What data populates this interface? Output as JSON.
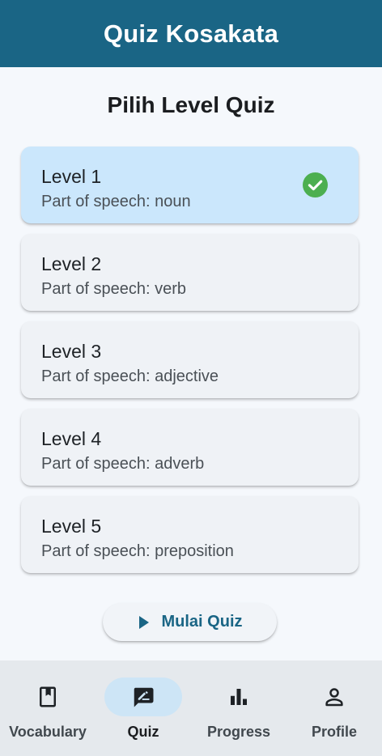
{
  "app_bar": {
    "title": "Quiz Kosakata"
  },
  "section_title": "Pilih Level Quiz",
  "levels": [
    {
      "name": "Level 1",
      "subtitle": "Part of speech: noun",
      "selected": true
    },
    {
      "name": "Level 2",
      "subtitle": "Part of speech: verb",
      "selected": false
    },
    {
      "name": "Level 3",
      "subtitle": "Part of speech: adjective",
      "selected": false
    },
    {
      "name": "Level 4",
      "subtitle": "Part of speech: adverb",
      "selected": false
    },
    {
      "name": "Level 5",
      "subtitle": "Part of speech: preposition",
      "selected": false
    }
  ],
  "start_button": {
    "label": "Mulai Quiz",
    "icon": "play-icon"
  },
  "bottom_nav": {
    "items": [
      {
        "label": "Vocabulary",
        "icon": "book-icon",
        "active": false
      },
      {
        "label": "Quiz",
        "icon": "quiz-edit-icon",
        "active": true
      },
      {
        "label": "Progress",
        "icon": "bar-chart-icon",
        "active": false
      },
      {
        "label": "Profile",
        "icon": "person-icon",
        "active": false
      }
    ]
  },
  "colors": {
    "primary": "#1a6585",
    "selected_card": "#cbe7fc",
    "check": "#4caf50",
    "nav_background": "#e5e9ed"
  }
}
